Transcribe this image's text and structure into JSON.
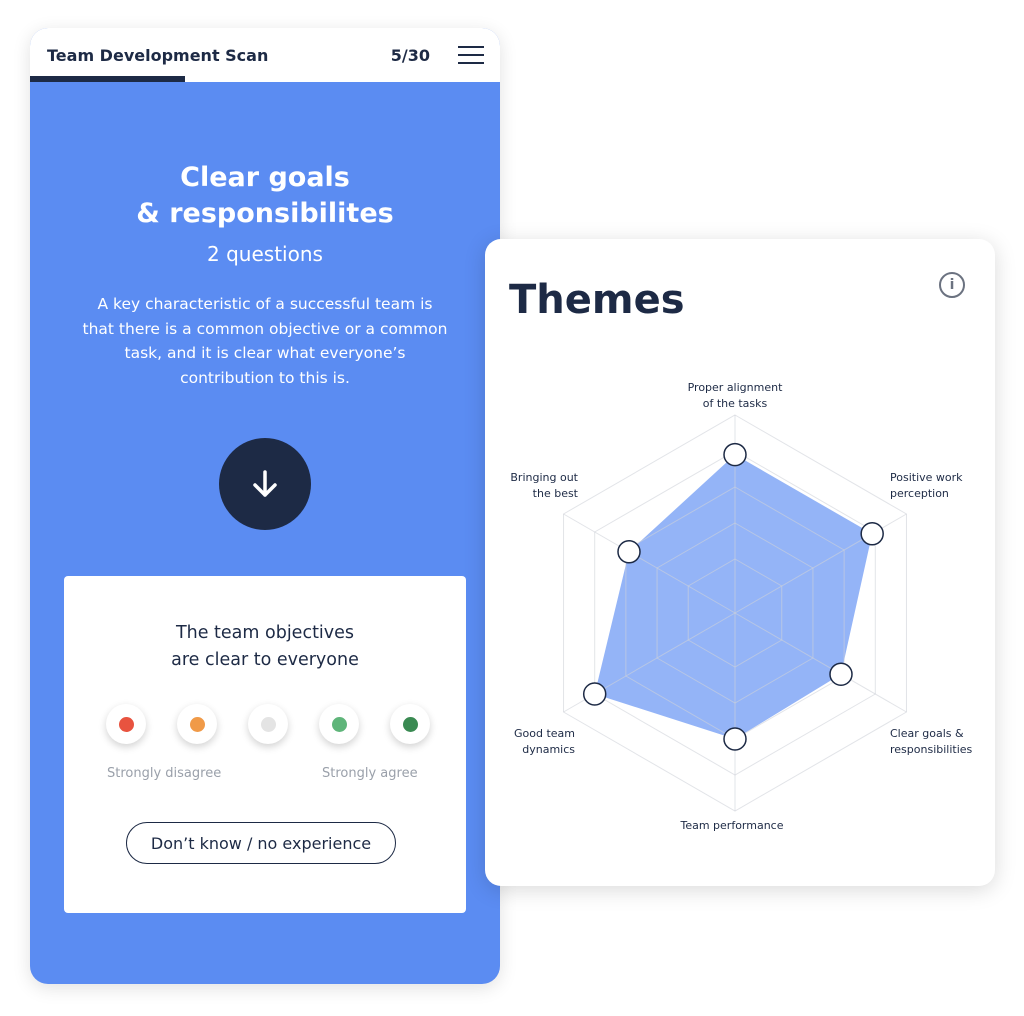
{
  "survey": {
    "title": "Team Development Scan",
    "counter": "5/30",
    "progress": 0.33,
    "section_title_1": "Clear goals",
    "section_title_2": "& responsibilites",
    "question_count": "2 questions",
    "description": "A key characteristic of a successful team is that there is a common objective or a common task, and it is clear what everyone’s contribution to this is.",
    "question_1": "The team objectives",
    "question_2": "are clear to everyone",
    "scale": [
      {
        "color": "#e8533f"
      },
      {
        "color": "#f09a48"
      },
      {
        "color": "#e4e4e4"
      },
      {
        "color": "#5fb57a"
      },
      {
        "color": "#3a8a52"
      }
    ],
    "label_low": "Strongly disagree",
    "label_high": "Strongly agree",
    "dont_know": "Don’t know / no experience"
  },
  "themes": {
    "title": "Themes",
    "info_icon": "info-icon"
  },
  "chart_data": {
    "type": "radar",
    "rings": [
      1.5,
      2.5,
      3.5,
      4.5,
      5.5
    ],
    "max": 5.5,
    "fill": "#5b8cf2",
    "axes": [
      [
        "Proper alignment",
        "of the tasks"
      ],
      [
        "Positive work",
        "perception"
      ],
      [
        "Clear goals &",
        "responsibilities"
      ],
      [
        "Team performance"
      ],
      [
        "Good team",
        "dynamics"
      ],
      [
        "Bringing out",
        "the best"
      ]
    ],
    "values": [
      4.4,
      4.4,
      3.4,
      3.5,
      4.5,
      3.4
    ]
  }
}
